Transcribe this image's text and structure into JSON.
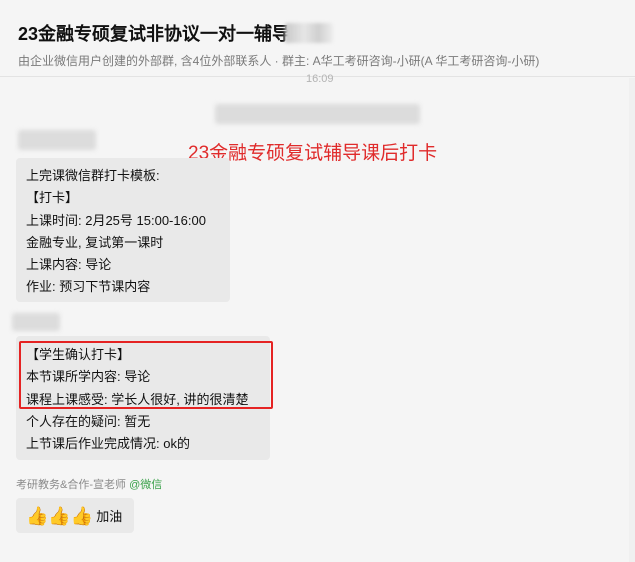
{
  "header": {
    "title": "23金融专硕复试非协议一对一辅导",
    "subtitle": "由企业微信用户创建的外部群, 含4位外部联系人 · 群主: A华工考研咨询-小研(A 华工考研咨询-小研)"
  },
  "chat": {
    "time": "16:09",
    "annotation": "23金融专硕复试辅导课后打卡",
    "message1": {
      "lines": [
        "上完课微信群打卡模板:",
        "【打卡】",
        "上课时间: 2月25号 15:00-16:00",
        "金融专业, 复试第一课时",
        "上课内容: 导论",
        "作业: 预习下节课内容"
      ]
    },
    "message2": {
      "lines": [
        "【学生确认打卡】",
        "本节课所学内容: 导论",
        "课程上课感受: 学长人很好, 讲的很清楚",
        "个人存在的疑问: 暂无",
        "上节课后作业完成情况: ok的"
      ]
    },
    "message3": {
      "sender_name": "考研教务&合作-宣老师",
      "sender_source": "@微信",
      "thumbs": "👍👍👍",
      "text": "加油"
    }
  },
  "colors": {
    "annotation": "#e02b2b",
    "highlight_box": "#e52323",
    "wechat_green": "#3aa14a",
    "bubble": "#e9e9e9"
  }
}
